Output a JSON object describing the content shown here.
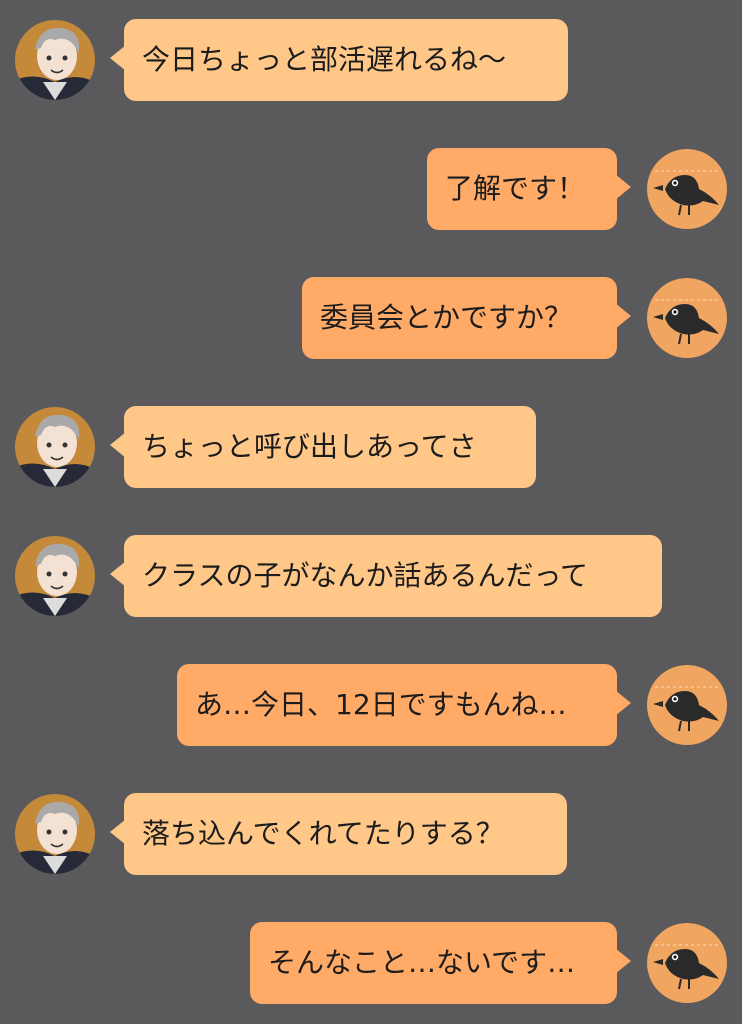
{
  "chat": {
    "messages": [
      {
        "side": "left",
        "sender": "senpai",
        "text": "今日ちょっと部活遅れるね〜"
      },
      {
        "side": "right",
        "sender": "kouhai",
        "text": "了解です！"
      },
      {
        "side": "right",
        "sender": "kouhai",
        "text": "委員会とかですか？"
      },
      {
        "side": "left",
        "sender": "senpai",
        "text": "ちょっと呼び出しあってさ"
      },
      {
        "side": "left",
        "sender": "senpai",
        "text": "クラスの子がなんか話あるんだって"
      },
      {
        "side": "right",
        "sender": "kouhai",
        "text": "あ…今日、12日ですもんね…"
      },
      {
        "side": "left",
        "sender": "senpai",
        "text": "落ち込んでくれてたりする？"
      },
      {
        "side": "right",
        "sender": "kouhai",
        "text": "そんなこと…ないです…"
      }
    ]
  },
  "colors": {
    "background": "#5a595b",
    "left_bubble": "#ffc788",
    "right_bubble": "#ffaa66"
  },
  "icons": {
    "left_avatar": "silver-haired-character-avatar-icon",
    "right_avatar": "crow-avatar-icon"
  }
}
